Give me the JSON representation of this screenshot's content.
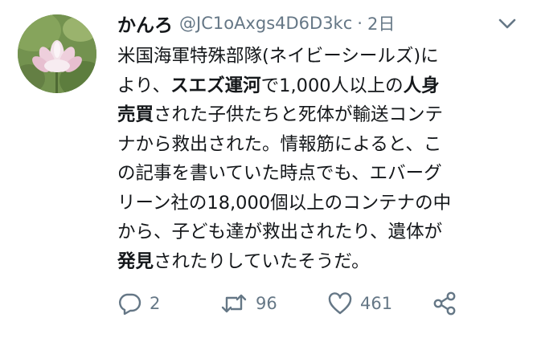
{
  "user": {
    "display_name": "かんろ",
    "handle": "@JC1oAxgs4D6D3kc",
    "separator": "·",
    "time": "2日"
  },
  "tweet": {
    "lines": [
      [
        {
          "t": "米国海軍特殊部隊(ネイビーシールズ)に",
          "b": false
        }
      ],
      [
        {
          "t": "より、",
          "b": false
        },
        {
          "t": "スエズ運河",
          "b": true
        },
        {
          "t": "で1,000人以上の",
          "b": false
        },
        {
          "t": "人身",
          "b": true
        }
      ],
      [
        {
          "t": "売買",
          "b": true
        },
        {
          "t": "された子供たちと死体が輸送コンテ",
          "b": false
        }
      ],
      [
        {
          "t": "ナから救出された。情報筋によると、こ",
          "b": false
        }
      ],
      [
        {
          "t": "の記事を書いていた時点でも、エバーグ",
          "b": false
        }
      ],
      [
        {
          "t": "リーン社の18,000個以上のコンテナの中",
          "b": false
        }
      ],
      [
        {
          "t": "から、子ども達が救出されたり、遺体が",
          "b": false
        }
      ],
      [
        {
          "t": "発見",
          "b": true
        },
        {
          "t": "されたりしていたそうだ。",
          "b": false
        }
      ]
    ]
  },
  "actions": {
    "reply_count": "2",
    "retweet_count": "96",
    "like_count": "461"
  },
  "icons": {
    "reply": "reply-icon",
    "retweet": "retweet-icon",
    "like": "heart-icon",
    "share": "share-icon",
    "menu": "chevron-down-icon"
  },
  "colors": {
    "text": "#14171a",
    "secondary": "#657786"
  }
}
